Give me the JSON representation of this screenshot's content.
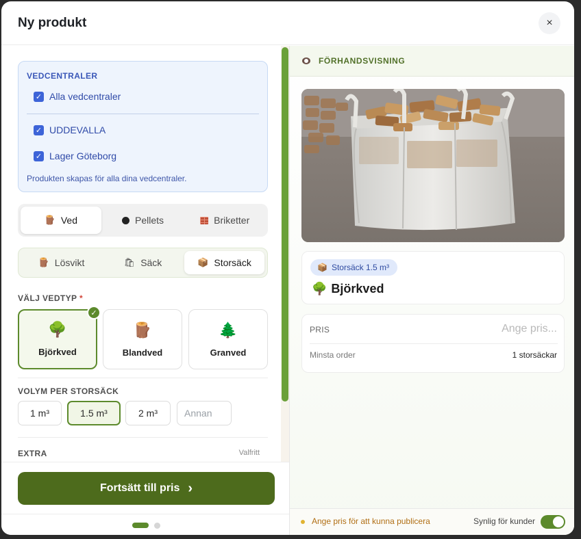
{
  "modal": {
    "title": "Ny produkt",
    "close_icon": "×"
  },
  "centers": {
    "heading": "VEDCENTRALER",
    "all_label": "Alla vedcentraler",
    "items": [
      "UDDEVALLA",
      "Lager Göteborg"
    ],
    "note": "Produkten skapas för alla dina vedcentraler."
  },
  "category_tabs": [
    {
      "label": "Ved",
      "icon": "log-icon",
      "active": true
    },
    {
      "label": "Pellets",
      "icon": "pellet-icon",
      "active": false
    },
    {
      "label": "Briketter",
      "icon": "brick-icon",
      "active": false
    }
  ],
  "package_tabs": [
    {
      "label": "Lösvikt",
      "icon": "log-icon",
      "active": false
    },
    {
      "label": "Säck",
      "icon": "sack-icon",
      "active": false
    },
    {
      "label": "Storsäck",
      "icon": "box-icon",
      "active": true
    }
  ],
  "wood_type": {
    "label": "VÄLJ VEDTYP",
    "required_mark": "*",
    "options": [
      {
        "label": "Björkved",
        "icon": "🌳",
        "selected": true
      },
      {
        "label": "Blandved",
        "icon": "🪵",
        "selected": false
      },
      {
        "label": "Granved",
        "icon": "🌲",
        "selected": false
      }
    ]
  },
  "volume": {
    "label": "VOLYM PER STORSÄCK",
    "options": [
      "1 m³",
      "1.5 m³",
      "2 m³"
    ],
    "selected": "1.5 m³",
    "other_placeholder": "Annan"
  },
  "extra": {
    "label": "EXTRA",
    "optional": "Valfritt"
  },
  "footer": {
    "continue_label": "Fortsätt till pris",
    "continue_arrow": "›",
    "step": 1,
    "steps": 2
  },
  "preview": {
    "label": "FÖRHANDSVISNING",
    "size_badge": "Storsäck 1.5 m³",
    "product_name": "Björkved",
    "product_icon": "🌳",
    "price_label": "PRIS",
    "price_placeholder": "Ange pris...",
    "min_order_label": "Minsta order",
    "min_order_value": "1 storsäckar",
    "warning": "Ange pris för att kunna publicera",
    "visible_label": "Synlig för kunder",
    "visible": true
  },
  "colors": {
    "accent": "#5c8a2c",
    "button": "#4d6b1c",
    "blue": "#3d64d8"
  }
}
